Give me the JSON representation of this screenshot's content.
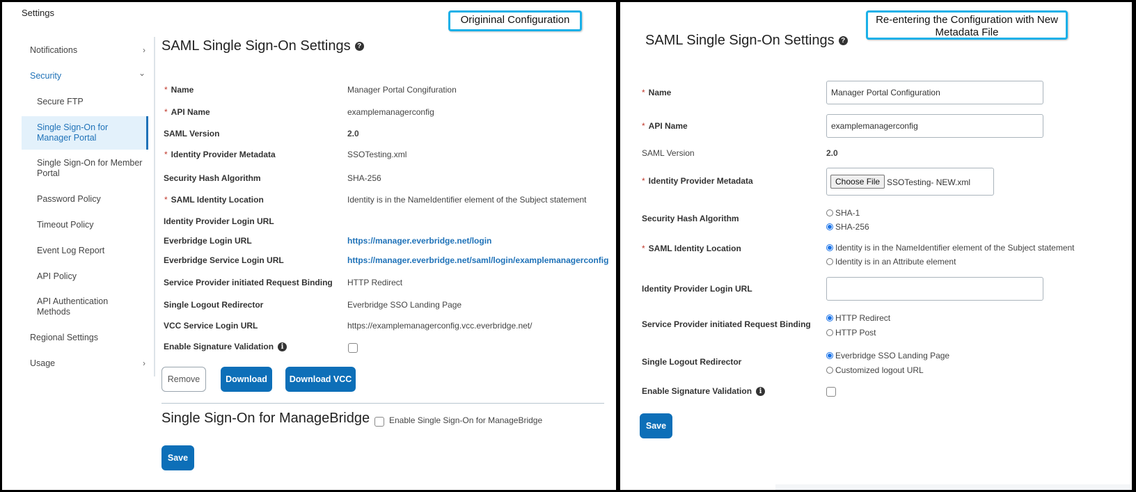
{
  "left": {
    "settings_label": "Settings",
    "callout": "Origininal Configuration",
    "sidebar": [
      {
        "label": "Notifications",
        "chevron": "›"
      },
      {
        "label": "Security",
        "chevron": "⌄"
      },
      {
        "label": "Secure FTP"
      },
      {
        "label": "Single Sign-On for Manager Portal"
      },
      {
        "label": "Single Sign-On for Member Portal"
      },
      {
        "label": "Password Policy"
      },
      {
        "label": "Timeout Policy"
      },
      {
        "label": "Event Log Report"
      },
      {
        "label": "API Policy"
      },
      {
        "label": "API Authentication Methods"
      },
      {
        "label": "Regional Settings"
      },
      {
        "label": "Usage",
        "chevron": "›"
      }
    ],
    "title": "SAML Single Sign-On Settings",
    "help_glyph": "?",
    "info_glyph": "i",
    "required_mark": "*",
    "fields": [
      {
        "label": "Name",
        "required": true,
        "value": "Manager Portal Congifuration"
      },
      {
        "label": "API Name",
        "required": true,
        "value": "examplemanagerconfig"
      },
      {
        "label": "SAML Version",
        "required": false,
        "value": "2.0"
      },
      {
        "label": "Identity Provider Metadata",
        "required": true,
        "value": "SSOTesting.xml"
      },
      {
        "label": "Security Hash Algorithm",
        "required": false,
        "value": "SHA-256"
      },
      {
        "label": "SAML Identity Location",
        "required": true,
        "value": "Identity is in the NameIdentifier element of the Subject statement"
      },
      {
        "label": "Identity Provider Login URL",
        "required": false,
        "value": ""
      },
      {
        "label": "Everbridge Login URL",
        "required": false,
        "value": "https://manager.everbridge.net/login"
      },
      {
        "label": "Everbridge Service Login URL",
        "required": false,
        "value": "https://manager.everbridge.net/saml/login/examplemanagerconfig"
      },
      {
        "label": "Service Provider initiated Request Binding",
        "required": false,
        "value": "HTTP Redirect"
      },
      {
        "label": "Single Logout Redirector",
        "required": false,
        "value": "Everbridge SSO Landing Page"
      },
      {
        "label": "VCC Service Login URL",
        "required": false,
        "value": "https://examplemanagerconfig.vcc.everbridge.net/"
      },
      {
        "label": "Enable Signature Validation",
        "required": false,
        "checked": false
      }
    ],
    "buttons": {
      "remove": "Remove",
      "download": "Download",
      "download_vcc": "Download VCC",
      "save": "Save"
    },
    "managebridge": {
      "title": "Single Sign-On for ManageBridge",
      "checkbox_label": "Enable Single Sign-On for ManageBridge",
      "checked": false
    }
  },
  "right": {
    "callout": "Re-entering the Configuration with New Metadata File",
    "title": "SAML Single Sign-On Settings",
    "help_glyph": "?",
    "info_glyph": "i",
    "required_mark": "*",
    "labels": {
      "name": "Name",
      "api_name": "API Name",
      "saml_version": "SAML Version",
      "idp_metadata": "Identity Provider Metadata",
      "hash": "Security Hash Algorithm",
      "identity_location": "SAML Identity Location",
      "idp_login_url": "Identity Provider Login URL",
      "binding": "Service Provider initiated Request Binding",
      "logout": "Single Logout Redirector",
      "signature": "Enable Signature Validation"
    },
    "values": {
      "name": "Manager Portal Configuration",
      "api_name": "examplemanagerconfig",
      "saml_version": "2.0",
      "choose_file": "Choose File",
      "file_name": "SSOTesting- NEW.xml",
      "idp_login_url": ""
    },
    "hash_options": [
      {
        "label": "SHA-1",
        "selected": false
      },
      {
        "label": "SHA-256",
        "selected": true
      }
    ],
    "identity_options": [
      {
        "label": "Identity is in the NameIdentifier element of the Subject statement",
        "selected": true
      },
      {
        "label": "Identity is in an Attribute element",
        "selected": false
      }
    ],
    "binding_options": [
      {
        "label": "HTTP Redirect",
        "selected": true
      },
      {
        "label": "HTTP Post",
        "selected": false
      }
    ],
    "logout_options": [
      {
        "label": "Everbridge SSO Landing Page",
        "selected": true
      },
      {
        "label": "Customized logout URL",
        "selected": false
      }
    ],
    "signature_checked": false,
    "save": "Save"
  },
  "colors": {
    "accent": "#0d6fb8",
    "callout_border": "#1ab0e8",
    "required": "#c0392b",
    "radio": "#1a73e8",
    "active_nav_bg": "#e3f1fb"
  }
}
